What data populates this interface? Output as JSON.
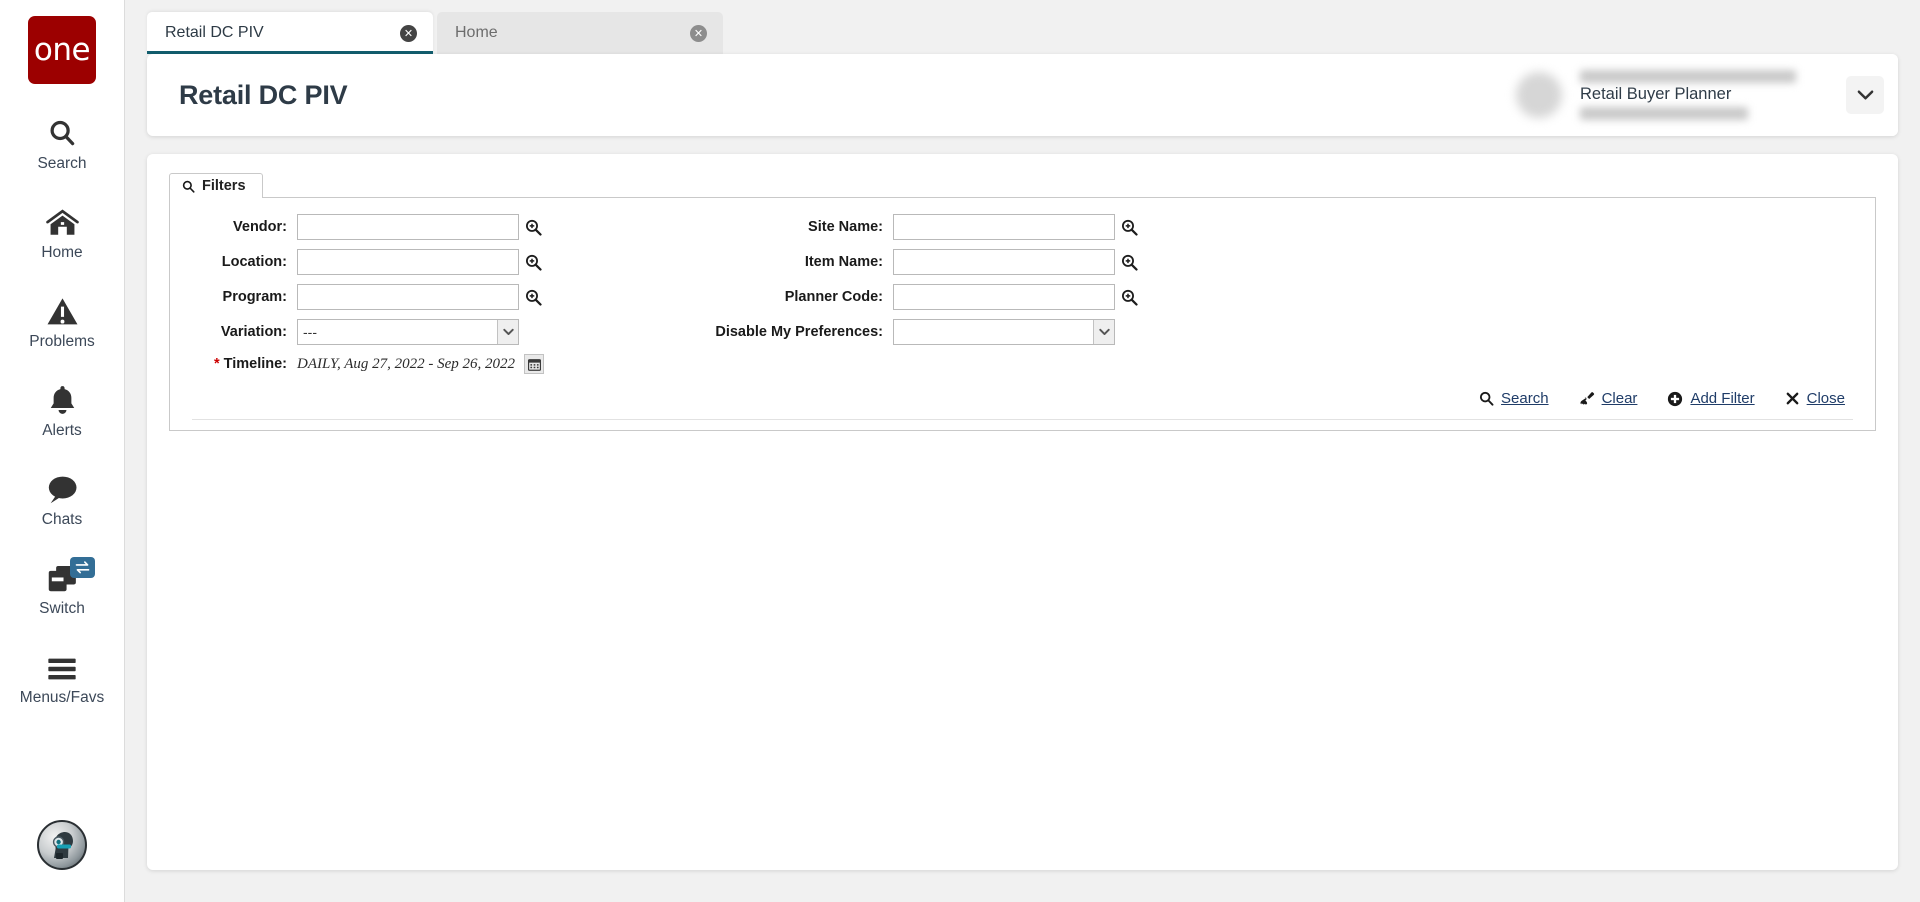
{
  "brand": {
    "logo_text": "one",
    "logo_color": "#9c0000"
  },
  "sidebar": {
    "items": [
      {
        "label": "Search",
        "icon": "search-icon"
      },
      {
        "label": "Home",
        "icon": "home-icon"
      },
      {
        "label": "Problems",
        "icon": "warning-triangle-icon"
      },
      {
        "label": "Alerts",
        "icon": "bell-icon"
      },
      {
        "label": "Chats",
        "icon": "chat-bubble-icon"
      },
      {
        "label": "Switch",
        "icon": "switch-windows-icon",
        "badge_icon": "exchange-arrows-icon"
      },
      {
        "label": "Menus/Favs",
        "icon": "hamburger-icon"
      }
    ],
    "assistant_avatar": "robot-head-icon"
  },
  "tabs": [
    {
      "label": "Retail DC PIV",
      "active": true,
      "close_icon": "close-circle-icon"
    },
    {
      "label": "Home",
      "active": false,
      "close_icon": "close-circle-icon"
    }
  ],
  "header": {
    "title": "Retail DC PIV",
    "buttons": [
      {
        "name": "favorite-button",
        "icon": "star-icon"
      },
      {
        "name": "refresh-button",
        "icon": "refresh-icon"
      },
      {
        "name": "close-button",
        "icon": "x-icon"
      }
    ],
    "menu_button_icon": "hamburger-icon",
    "accent_color": "#0f5c70"
  },
  "user": {
    "name_redacted": true,
    "role": "Retail Buyer Planner",
    "dropdown_icon": "chevron-down-icon"
  },
  "filters": {
    "tab_label": "Filters",
    "tab_icon": "search-icon",
    "fields": {
      "vendor": {
        "label": "Vendor:",
        "value": "",
        "lookup_icon": "magnifier-plus-icon"
      },
      "location": {
        "label": "Location:",
        "value": "",
        "lookup_icon": "magnifier-plus-icon"
      },
      "program": {
        "label": "Program:",
        "value": "",
        "lookup_icon": "magnifier-plus-icon"
      },
      "variation": {
        "label": "Variation:",
        "value": "---"
      },
      "site_name": {
        "label": "Site Name:",
        "value": "",
        "lookup_icon": "magnifier-plus-icon"
      },
      "item_name": {
        "label": "Item Name:",
        "value": "",
        "lookup_icon": "magnifier-plus-icon"
      },
      "planner_code": {
        "label": "Planner Code:",
        "value": "",
        "lookup_icon": "magnifier-plus-icon"
      },
      "disable_my_preferences": {
        "label": "Disable My Preferences:",
        "value": ""
      },
      "timeline": {
        "label": "Timeline:",
        "required": true,
        "value": "DAILY, Aug 27, 2022 - Sep 26, 2022",
        "calendar_icon": "calendar-icon"
      }
    },
    "actions": [
      {
        "label": "Search",
        "icon": "search-icon"
      },
      {
        "label": "Clear",
        "icon": "broom-icon"
      },
      {
        "label": "Add Filter",
        "icon": "plus-circle-icon"
      },
      {
        "label": "Close",
        "icon": "x-icon"
      }
    ]
  }
}
